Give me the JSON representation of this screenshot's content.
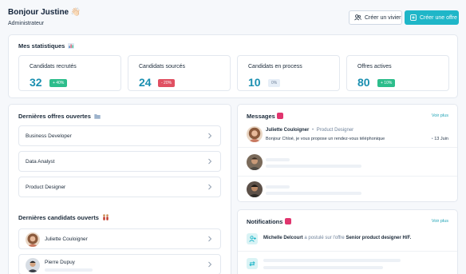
{
  "header": {
    "greeting": "Bonjour Justine",
    "greeting_emoji": "👋🏻",
    "role": "Administrateur",
    "create_vivier_label": "Créer un vivier",
    "create_offer_label": "Créer une offre"
  },
  "stats": {
    "title": "Mes statistiques",
    "items": [
      {
        "label": "Candidats recrutés",
        "value": "32",
        "badge": "+ 40%",
        "tone": "green"
      },
      {
        "label": "Candidats sourcés",
        "value": "24",
        "badge": "- 20%",
        "tone": "red"
      },
      {
        "label": "Candidats en process",
        "value": "10",
        "badge": "0%",
        "tone": "grey"
      },
      {
        "label": "Offres actives",
        "value": "80",
        "badge": "+ 10%",
        "tone": "green"
      }
    ]
  },
  "offers": {
    "title": "Dernières offres ouvertes",
    "items": [
      "Business Developer",
      "Data Analyst",
      "Product Designer"
    ]
  },
  "candidates": {
    "title": "Dernières candidats ouverts",
    "items": [
      "Juliette Couloigner",
      "Pierre Dupuy"
    ]
  },
  "messages": {
    "title": "Messages",
    "see_more": "Voir plus",
    "first": {
      "name": "Juliette Couloigner",
      "role": "Product Designer",
      "preview": "Bonjour Chloé, je vous propose un rendez-vous téléphonique",
      "date": "13 Juin"
    }
  },
  "notifications": {
    "title": "Notifications",
    "see_more": "Voir plus",
    "first": {
      "name": "Michelle Delcourt",
      "action": "a postulé sur l'offre",
      "offer": "Senior product designer H/F."
    }
  },
  "colors": {
    "accent": "#1fb6c8",
    "value": "#1a8fb0",
    "positive": "#2dbd8b",
    "negative": "#e05062",
    "badge_pink": "#e0356e"
  }
}
